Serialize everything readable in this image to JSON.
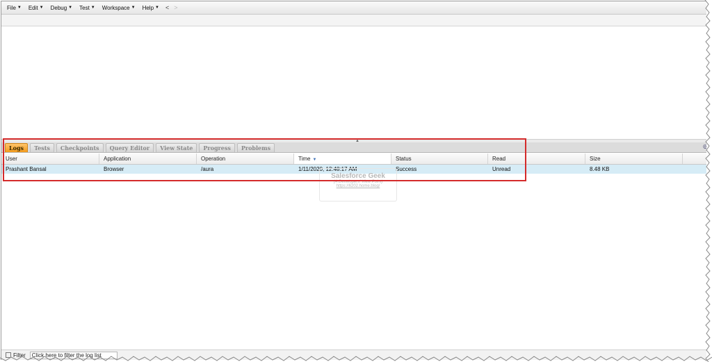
{
  "menubar": {
    "items": [
      {
        "label": "File"
      },
      {
        "label": "Edit"
      },
      {
        "label": "Debug"
      },
      {
        "label": "Test"
      },
      {
        "label": "Workspace"
      },
      {
        "label": "Help"
      }
    ],
    "back_arrow": "<",
    "forward_arrow": ">"
  },
  "tabs": [
    {
      "label": "Logs",
      "active": true
    },
    {
      "label": "Tests"
    },
    {
      "label": "Checkpoints"
    },
    {
      "label": "Query Editor"
    },
    {
      "label": "View State"
    },
    {
      "label": "Progress"
    },
    {
      "label": "Problems"
    }
  ],
  "grid": {
    "columns": [
      "User",
      "Application",
      "Operation",
      "Time",
      "Status",
      "Read",
      "Size"
    ],
    "sorted_column": "Time",
    "rows": [
      {
        "user": "Prashant Bansal",
        "application": "Browser",
        "operation": "/aura",
        "time": "1/11/2020, 12:48:17 AM",
        "status": "Success",
        "read": "Unread",
        "size": "8.48 KB"
      }
    ]
  },
  "watermark": {
    "title": "Salesforce Geek",
    "subtitle": "(A Developers' View Point)",
    "url": "https://6202.home.blog/"
  },
  "filter": {
    "label": "Filter",
    "placeholder": "Click here to filter the log list"
  },
  "colors": {
    "active_tab": "#f29a1c",
    "selected_row": "#d6ecf6",
    "highlight_border": "#d42a2a"
  }
}
